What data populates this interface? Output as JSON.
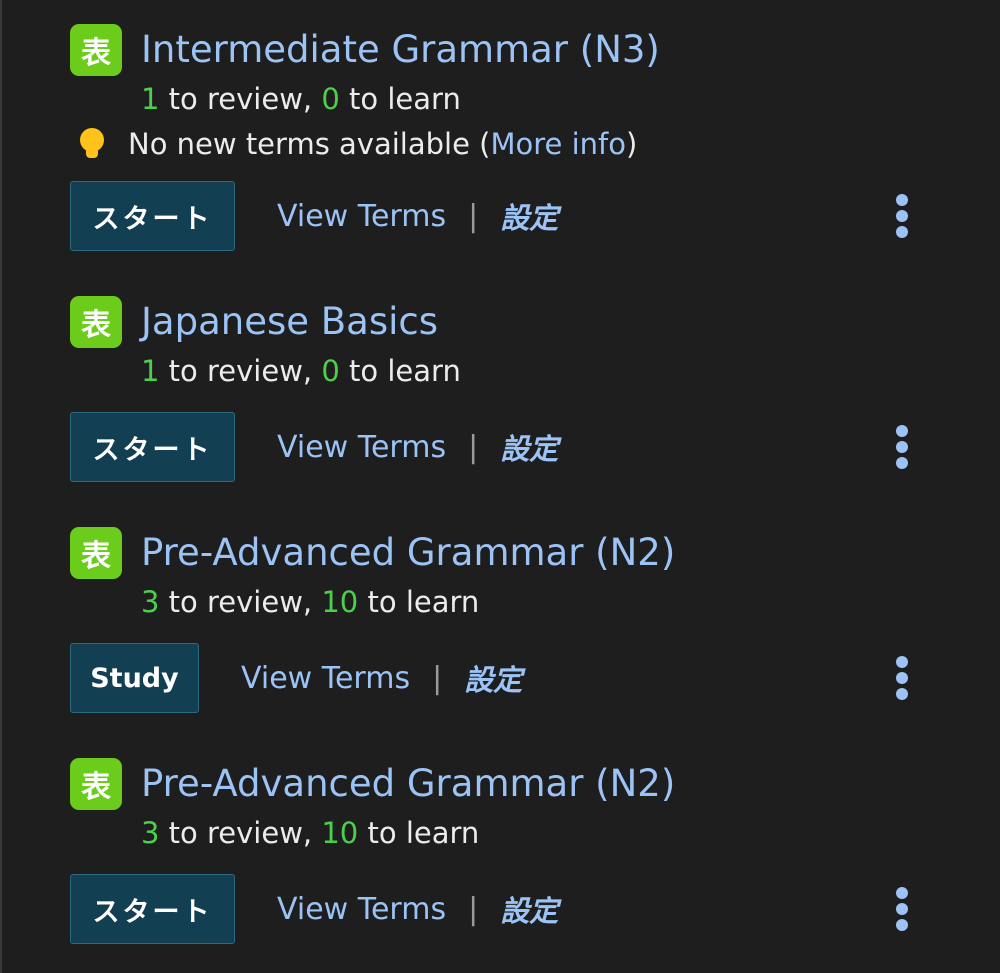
{
  "decks": [
    {
      "title": "Intermediate Grammar (N3)",
      "icon_glyph": "表",
      "review_count": "1",
      "review_text": " to review, ",
      "learn_count": "0",
      "learn_text": " to learn",
      "notice": {
        "prefix": "No new terms available (",
        "link": "More info",
        "suffix": ")"
      },
      "start_label": "スタート",
      "view_terms_label": "View Terms",
      "separator": "|",
      "settings_label": "設定"
    },
    {
      "title": "Japanese Basics",
      "icon_glyph": "表",
      "review_count": "1",
      "review_text": " to review, ",
      "learn_count": "0",
      "learn_text": " to learn",
      "start_label": "スタート",
      "view_terms_label": "View Terms",
      "separator": "|",
      "settings_label": "設定"
    },
    {
      "title": "Pre-Advanced Grammar (N2)",
      "icon_glyph": "表",
      "review_count": "3",
      "review_text": " to review, ",
      "learn_count": "10",
      "learn_text": " to learn",
      "start_label": "Study",
      "view_terms_label": "View Terms",
      "separator": "|",
      "settings_label": "設定"
    },
    {
      "title": "Pre-Advanced Grammar (N2)",
      "icon_glyph": "表",
      "review_count": "3",
      "review_text": " to review, ",
      "learn_count": "10",
      "learn_text": " to learn",
      "start_label": "スタート",
      "view_terms_label": "View Terms",
      "separator": "|",
      "settings_label": "設定"
    }
  ],
  "colors": {
    "background": "#1e1e1e",
    "link": "#9cc3f5",
    "count": "#4ad04a",
    "icon": "#6ccc1c",
    "button": "#133f52"
  },
  "icons": {
    "deck": "deck-icon",
    "notice": "lightbulb-icon",
    "menu": "more-vertical-icon"
  }
}
